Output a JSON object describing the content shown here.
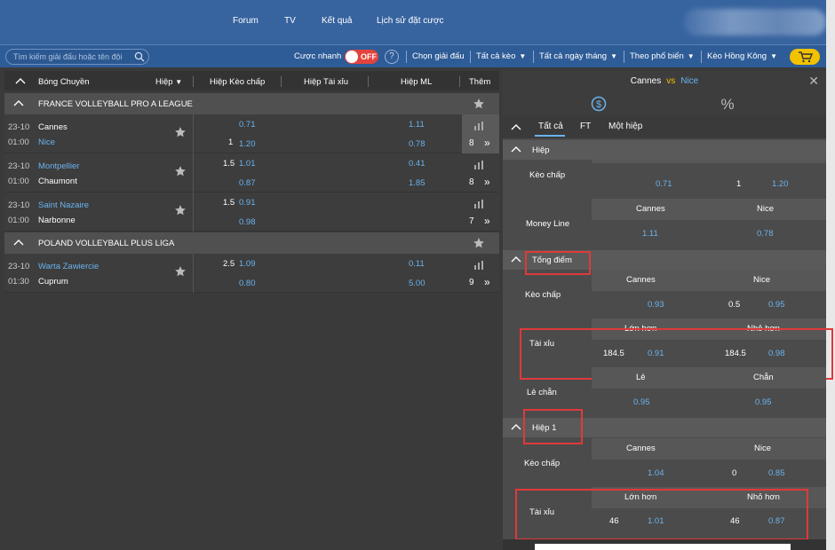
{
  "nav": {
    "forum": "Forum",
    "tv": "TV",
    "results": "Kết quả",
    "history": "Lịch sử đặt cược"
  },
  "filter": {
    "search_placeholder": "Tìm kiếm giải đấu hoặc tên đội",
    "quick_bet": "Cược nhanh",
    "toggle_state": "OFF",
    "help": "?",
    "choose_league": "Chọn giải đấu",
    "all_odds": "Tất cả kèo",
    "all_dates": "Tất cả ngày tháng",
    "popularity": "Theo phổ biến",
    "odds_type": "Kèo Hồng Kông"
  },
  "left": {
    "headers": {
      "sport": "Bóng Chuyền",
      "period": "Hiệp",
      "handicap": "Hiệp Kèo chấp",
      "over_under": "Hiệp Tài xỉu",
      "ml": "Hiệp ML",
      "more": "Thêm"
    },
    "leagues": [
      {
        "name": "FRANCE VOLLEYBALL PRO A LEAGUE",
        "matches": [
          {
            "date": "23-10",
            "time": "01:00",
            "home": "Cannes",
            "away": "Nice",
            "hcp_line_home": "",
            "hcp_home": "0.71",
            "hcp_line_away": "1",
            "hcp_away": "1.20",
            "ml_home": "1.11",
            "ml_away": "0.78",
            "more": "8"
          },
          {
            "date": "23-10",
            "time": "01:00",
            "home": "Montpellier",
            "away": "Chaumont",
            "hcp_line_home": "1.5",
            "hcp_home": "1.01",
            "hcp_line_away": "",
            "hcp_away": "0.87",
            "ml_home": "0.41",
            "ml_away": "1.85",
            "more": "8"
          },
          {
            "date": "23-10",
            "time": "01:00",
            "home": "Saint Nazaire",
            "away": "Narbonne",
            "hcp_line_home": "1.5",
            "hcp_home": "0.91",
            "hcp_line_away": "",
            "hcp_away": "0.98",
            "ml_home": "",
            "ml_away": "",
            "more": "7"
          }
        ]
      },
      {
        "name": "POLAND VOLLEYBALL PLUS LIGA",
        "matches": [
          {
            "date": "23-10",
            "time": "01:30",
            "home": "Warta Zawiercie",
            "away": "Cuprum",
            "hcp_line_home": "2.5",
            "hcp_home": "1.09",
            "hcp_line_away": "",
            "hcp_away": "0.80",
            "ml_home": "0.11",
            "ml_away": "5.00",
            "more": "9"
          }
        ]
      }
    ]
  },
  "right": {
    "home": "Cannes",
    "vs": "vs",
    "away": "Nice",
    "tabs": [
      "Tất cả",
      "FT",
      "Một hiệp"
    ],
    "sections": {
      "period": {
        "title": "Hiệp",
        "rows": {
          "handicap": {
            "label": "Kèo chấp",
            "col_home": "Cannes",
            "col_away": "Nice",
            "home": "0.71",
            "away_line": "1",
            "away": "1.20"
          },
          "moneyline": {
            "label": "Money Line",
            "col_home": "Cannes",
            "col_away": "Nice",
            "home": "1.11",
            "away": "0.78"
          }
        }
      },
      "total": {
        "title": "Tổng điểm",
        "rows": {
          "handicap": {
            "label": "Kèo chấp",
            "col_home": "Cannes",
            "col_away": "Nice",
            "home": "0.93",
            "away_line": "0.5",
            "away": "0.95"
          },
          "over_under": {
            "label": "Tài xỉu",
            "col_over": "Lớn hơn",
            "col_under": "Nhỏ hơn",
            "over_line": "184.5",
            "over": "0.91",
            "under_line": "184.5",
            "under": "0.98"
          },
          "odd_even": {
            "label": "Lẻ chẵn",
            "col_odd": "Lẻ",
            "col_even": "Chẵn",
            "odd": "0.95",
            "even": "0.95"
          }
        }
      },
      "set1": {
        "title": "Hiệp 1",
        "rows": {
          "handicap": {
            "label": "Kèo chấp",
            "col_home": "Cannes",
            "col_away": "Nice",
            "home": "1.04",
            "away_line": "0",
            "away": "0.85"
          },
          "over_under": {
            "label": "Tài xỉu",
            "col_over": "Lớn hơn",
            "col_under": "Nhỏ hơn",
            "over_line": "46",
            "over": "1.01",
            "under_line": "46",
            "under": "0.87"
          }
        }
      }
    }
  },
  "colors": {
    "header_blue": "#37639f",
    "odds_blue": "#6ab3ee",
    "highlight_red": "#e0393a",
    "toggle_red": "#e3433d",
    "cart_yellow": "#f2c200"
  }
}
